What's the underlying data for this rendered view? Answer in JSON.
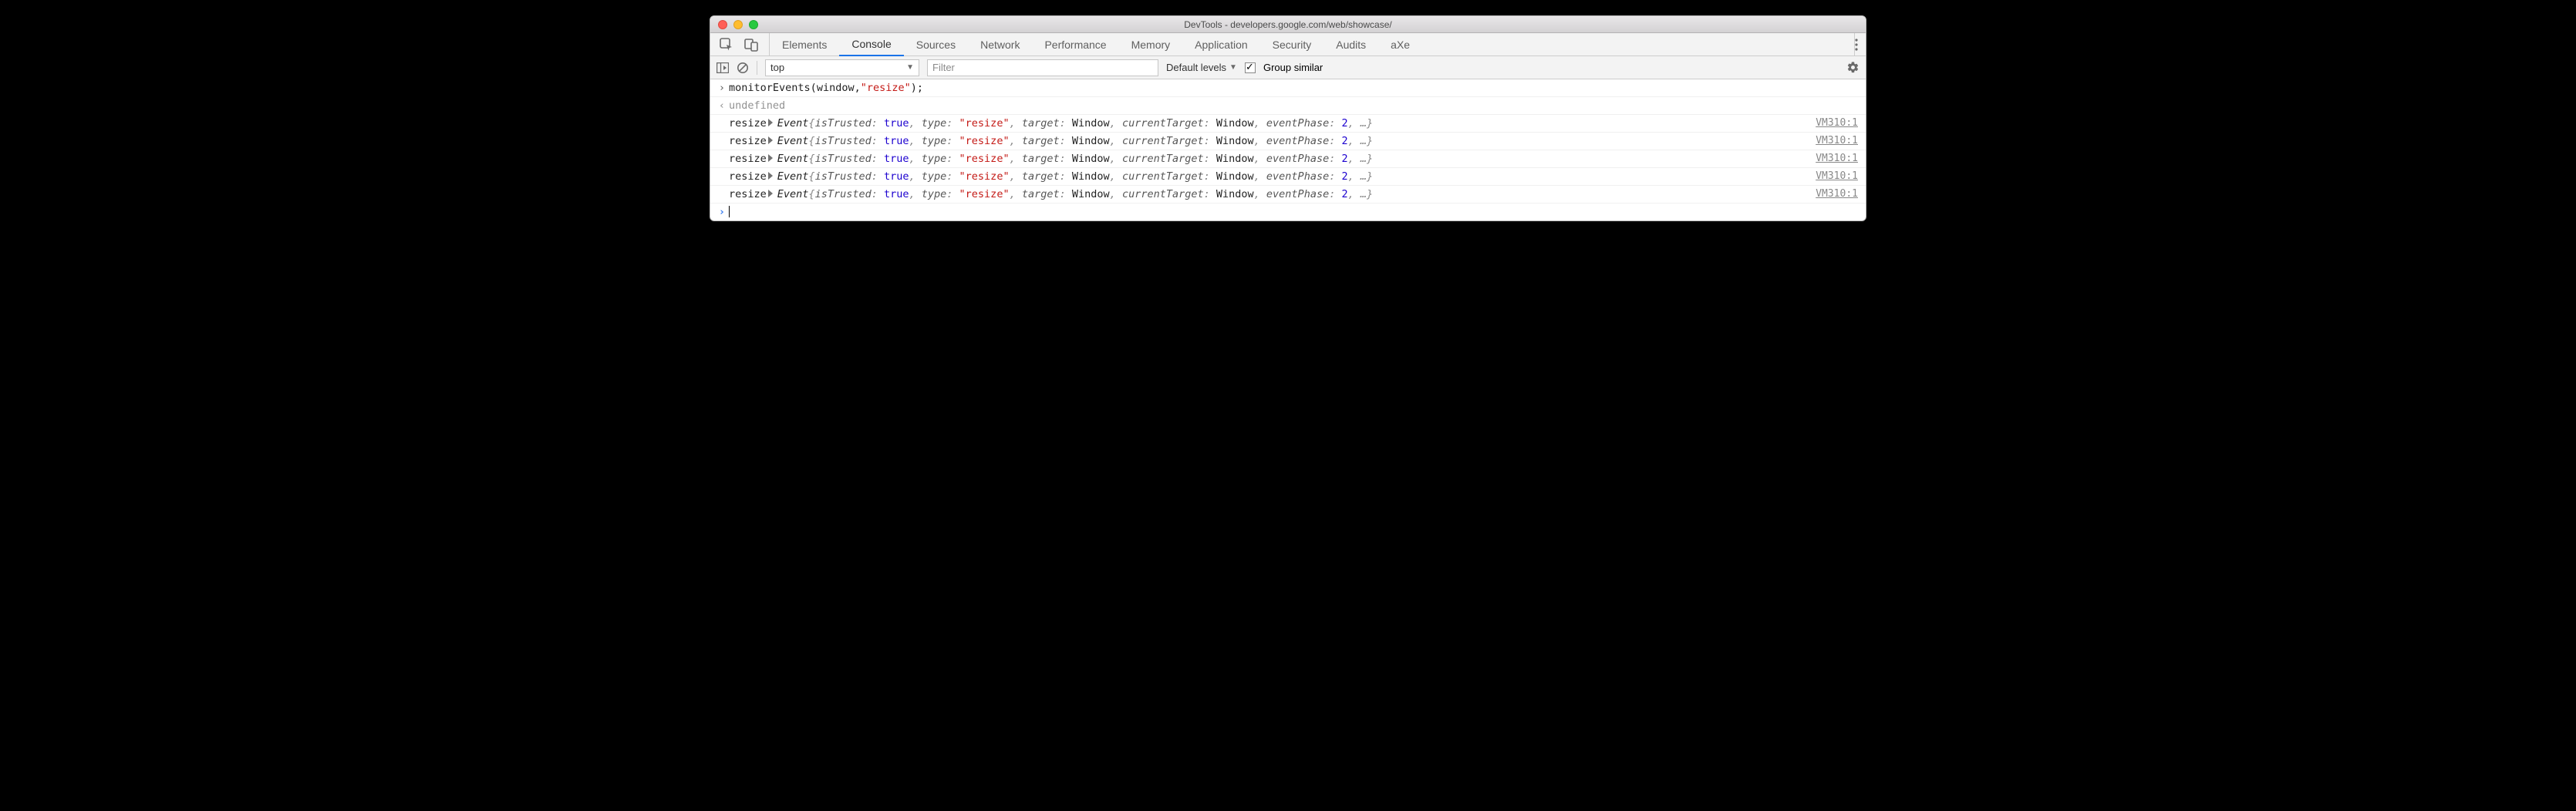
{
  "window": {
    "title": "DevTools - developers.google.com/web/showcase/"
  },
  "tabs": {
    "items": [
      "Elements",
      "Console",
      "Sources",
      "Network",
      "Performance",
      "Memory",
      "Application",
      "Security",
      "Audits",
      "aXe"
    ],
    "active": "Console"
  },
  "toolbar": {
    "context": "top",
    "filter_placeholder": "Filter",
    "levels": "Default levels",
    "group_checked": true,
    "group_label": "Group similar"
  },
  "console": {
    "input": {
      "raw": "monitorEvents(window, \"resize\");",
      "func": "monitorEvents",
      "open": "(",
      "arg1": "window",
      "comma": ", ",
      "arg2": "\"resize\"",
      "close": ");"
    },
    "result": "undefined",
    "events": [
      {
        "label": "resize",
        "source": "VM310:1",
        "obj": {
          "type": "Event",
          "isTrusted": "true",
          "typeVal": "\"resize\"",
          "target": "Window",
          "currentTarget": "Window",
          "eventPhase": "2"
        }
      },
      {
        "label": "resize",
        "source": "VM310:1",
        "obj": {
          "type": "Event",
          "isTrusted": "true",
          "typeVal": "\"resize\"",
          "target": "Window",
          "currentTarget": "Window",
          "eventPhase": "2"
        }
      },
      {
        "label": "resize",
        "source": "VM310:1",
        "obj": {
          "type": "Event",
          "isTrusted": "true",
          "typeVal": "\"resize\"",
          "target": "Window",
          "currentTarget": "Window",
          "eventPhase": "2"
        }
      },
      {
        "label": "resize",
        "source": "VM310:1",
        "obj": {
          "type": "Event",
          "isTrusted": "true",
          "typeVal": "\"resize\"",
          "target": "Window",
          "currentTarget": "Window",
          "eventPhase": "2"
        }
      },
      {
        "label": "resize",
        "source": "VM310:1",
        "obj": {
          "type": "Event",
          "isTrusted": "true",
          "typeVal": "\"resize\"",
          "target": "Window",
          "currentTarget": "Window",
          "eventPhase": "2"
        }
      }
    ]
  }
}
